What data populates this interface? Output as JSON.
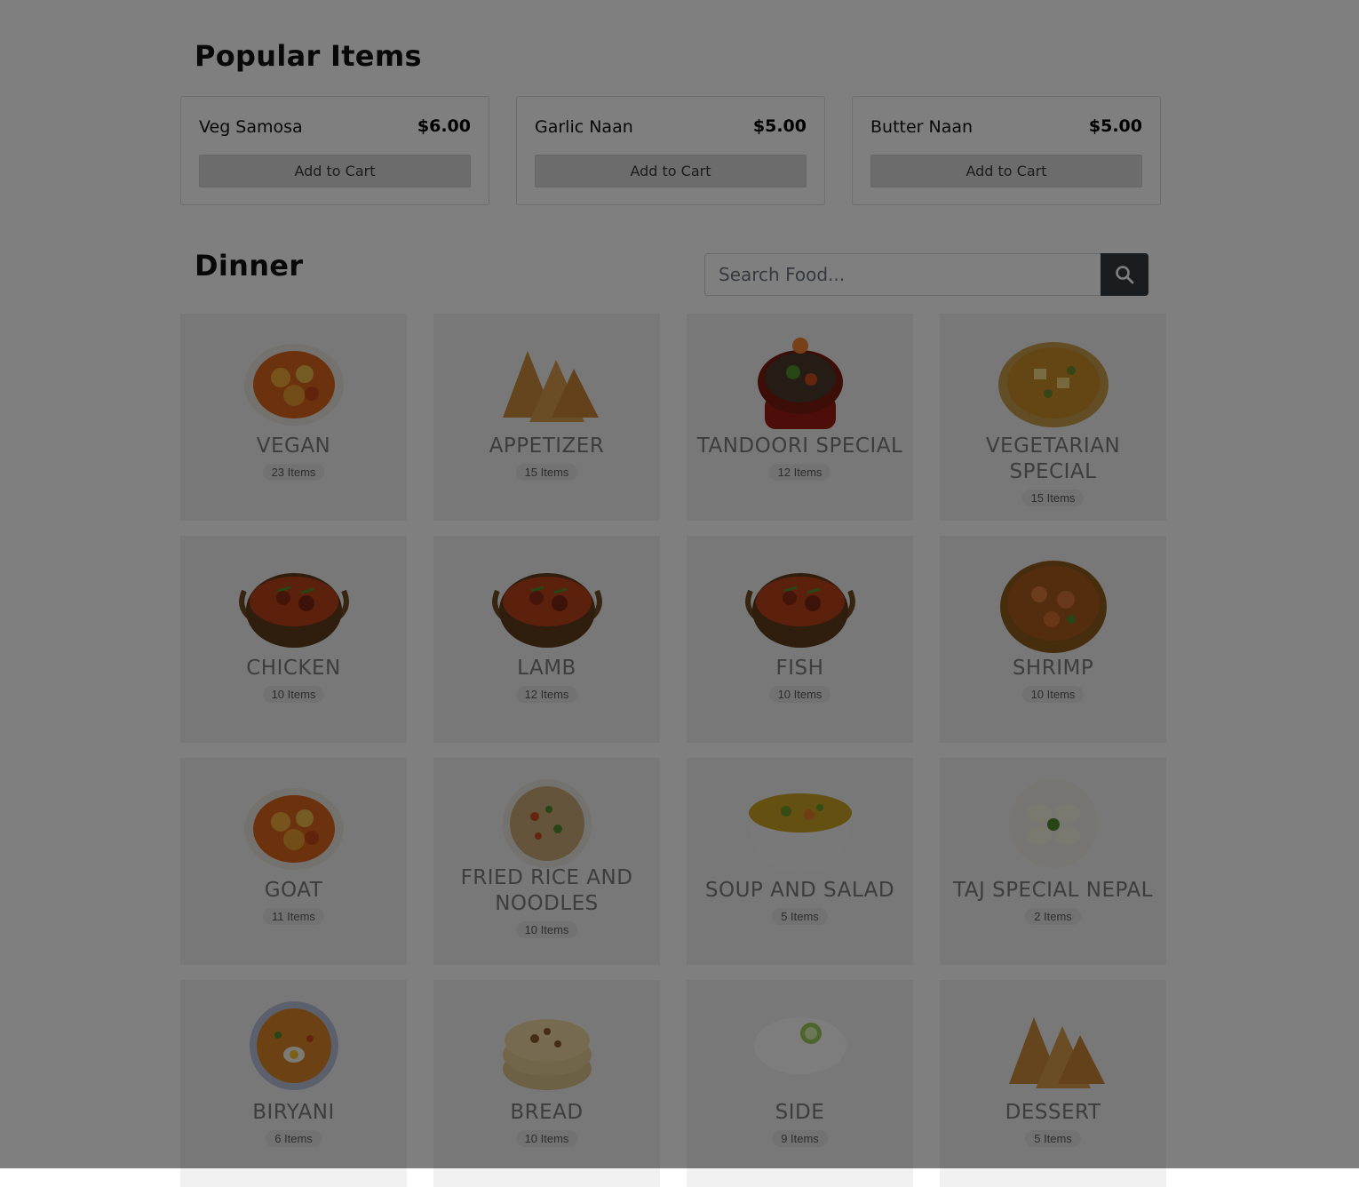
{
  "popular": {
    "title": "Popular Items",
    "items": [
      {
        "name": "Veg Samosa",
        "price": "$6.00",
        "button": "Add to Cart"
      },
      {
        "name": "Garlic Naan",
        "price": "$5.00",
        "button": "Add to Cart"
      },
      {
        "name": "Butter Naan",
        "price": "$5.00",
        "button": "Add to Cart"
      }
    ]
  },
  "dinner": {
    "title": "Dinner",
    "search": {
      "placeholder": "Search Food..."
    },
    "categories": [
      {
        "name": "VEGAN",
        "count": "23 Items",
        "image": "curry-plate"
      },
      {
        "name": "APPETIZER",
        "count": "15 Items",
        "image": "samosas"
      },
      {
        "name": "TANDOORI SPECIAL",
        "count": "12 Items",
        "image": "sizzler-bowl"
      },
      {
        "name": "VEGETARIAN SPECIAL",
        "count": "15 Items",
        "image": "paneer-bowl"
      },
      {
        "name": "CHICKEN",
        "count": "10 Items",
        "image": "kadai-curry"
      },
      {
        "name": "LAMB",
        "count": "12 Items",
        "image": "kadai-curry"
      },
      {
        "name": "FISH",
        "count": "10 Items",
        "image": "kadai-curry"
      },
      {
        "name": "SHRIMP",
        "count": "10 Items",
        "image": "curry-bowl"
      },
      {
        "name": "GOAT",
        "count": "11 Items",
        "image": "curry-plate"
      },
      {
        "name": "FRIED RICE AND NOODLES",
        "count": "10 Items",
        "image": "rice-plate"
      },
      {
        "name": "SOUP AND SALAD",
        "count": "5 Items",
        "image": "soup-bowl"
      },
      {
        "name": "TAJ SPECIAL NEPAL",
        "count": "2 Items",
        "image": "momo-plate"
      },
      {
        "name": "BIRYANI",
        "count": "6 Items",
        "image": "biryani-plate"
      },
      {
        "name": "BREAD",
        "count": "10 Items",
        "image": "naan-stack"
      },
      {
        "name": "SIDE",
        "count": "9 Items",
        "image": "raita-bowl"
      },
      {
        "name": "DESSERT",
        "count": "5 Items",
        "image": "samosas"
      }
    ]
  },
  "colors": {
    "search_button": "#343a40",
    "card_background": "#f1f1f1",
    "overlay": "rgba(0,0,0,0.5)"
  }
}
